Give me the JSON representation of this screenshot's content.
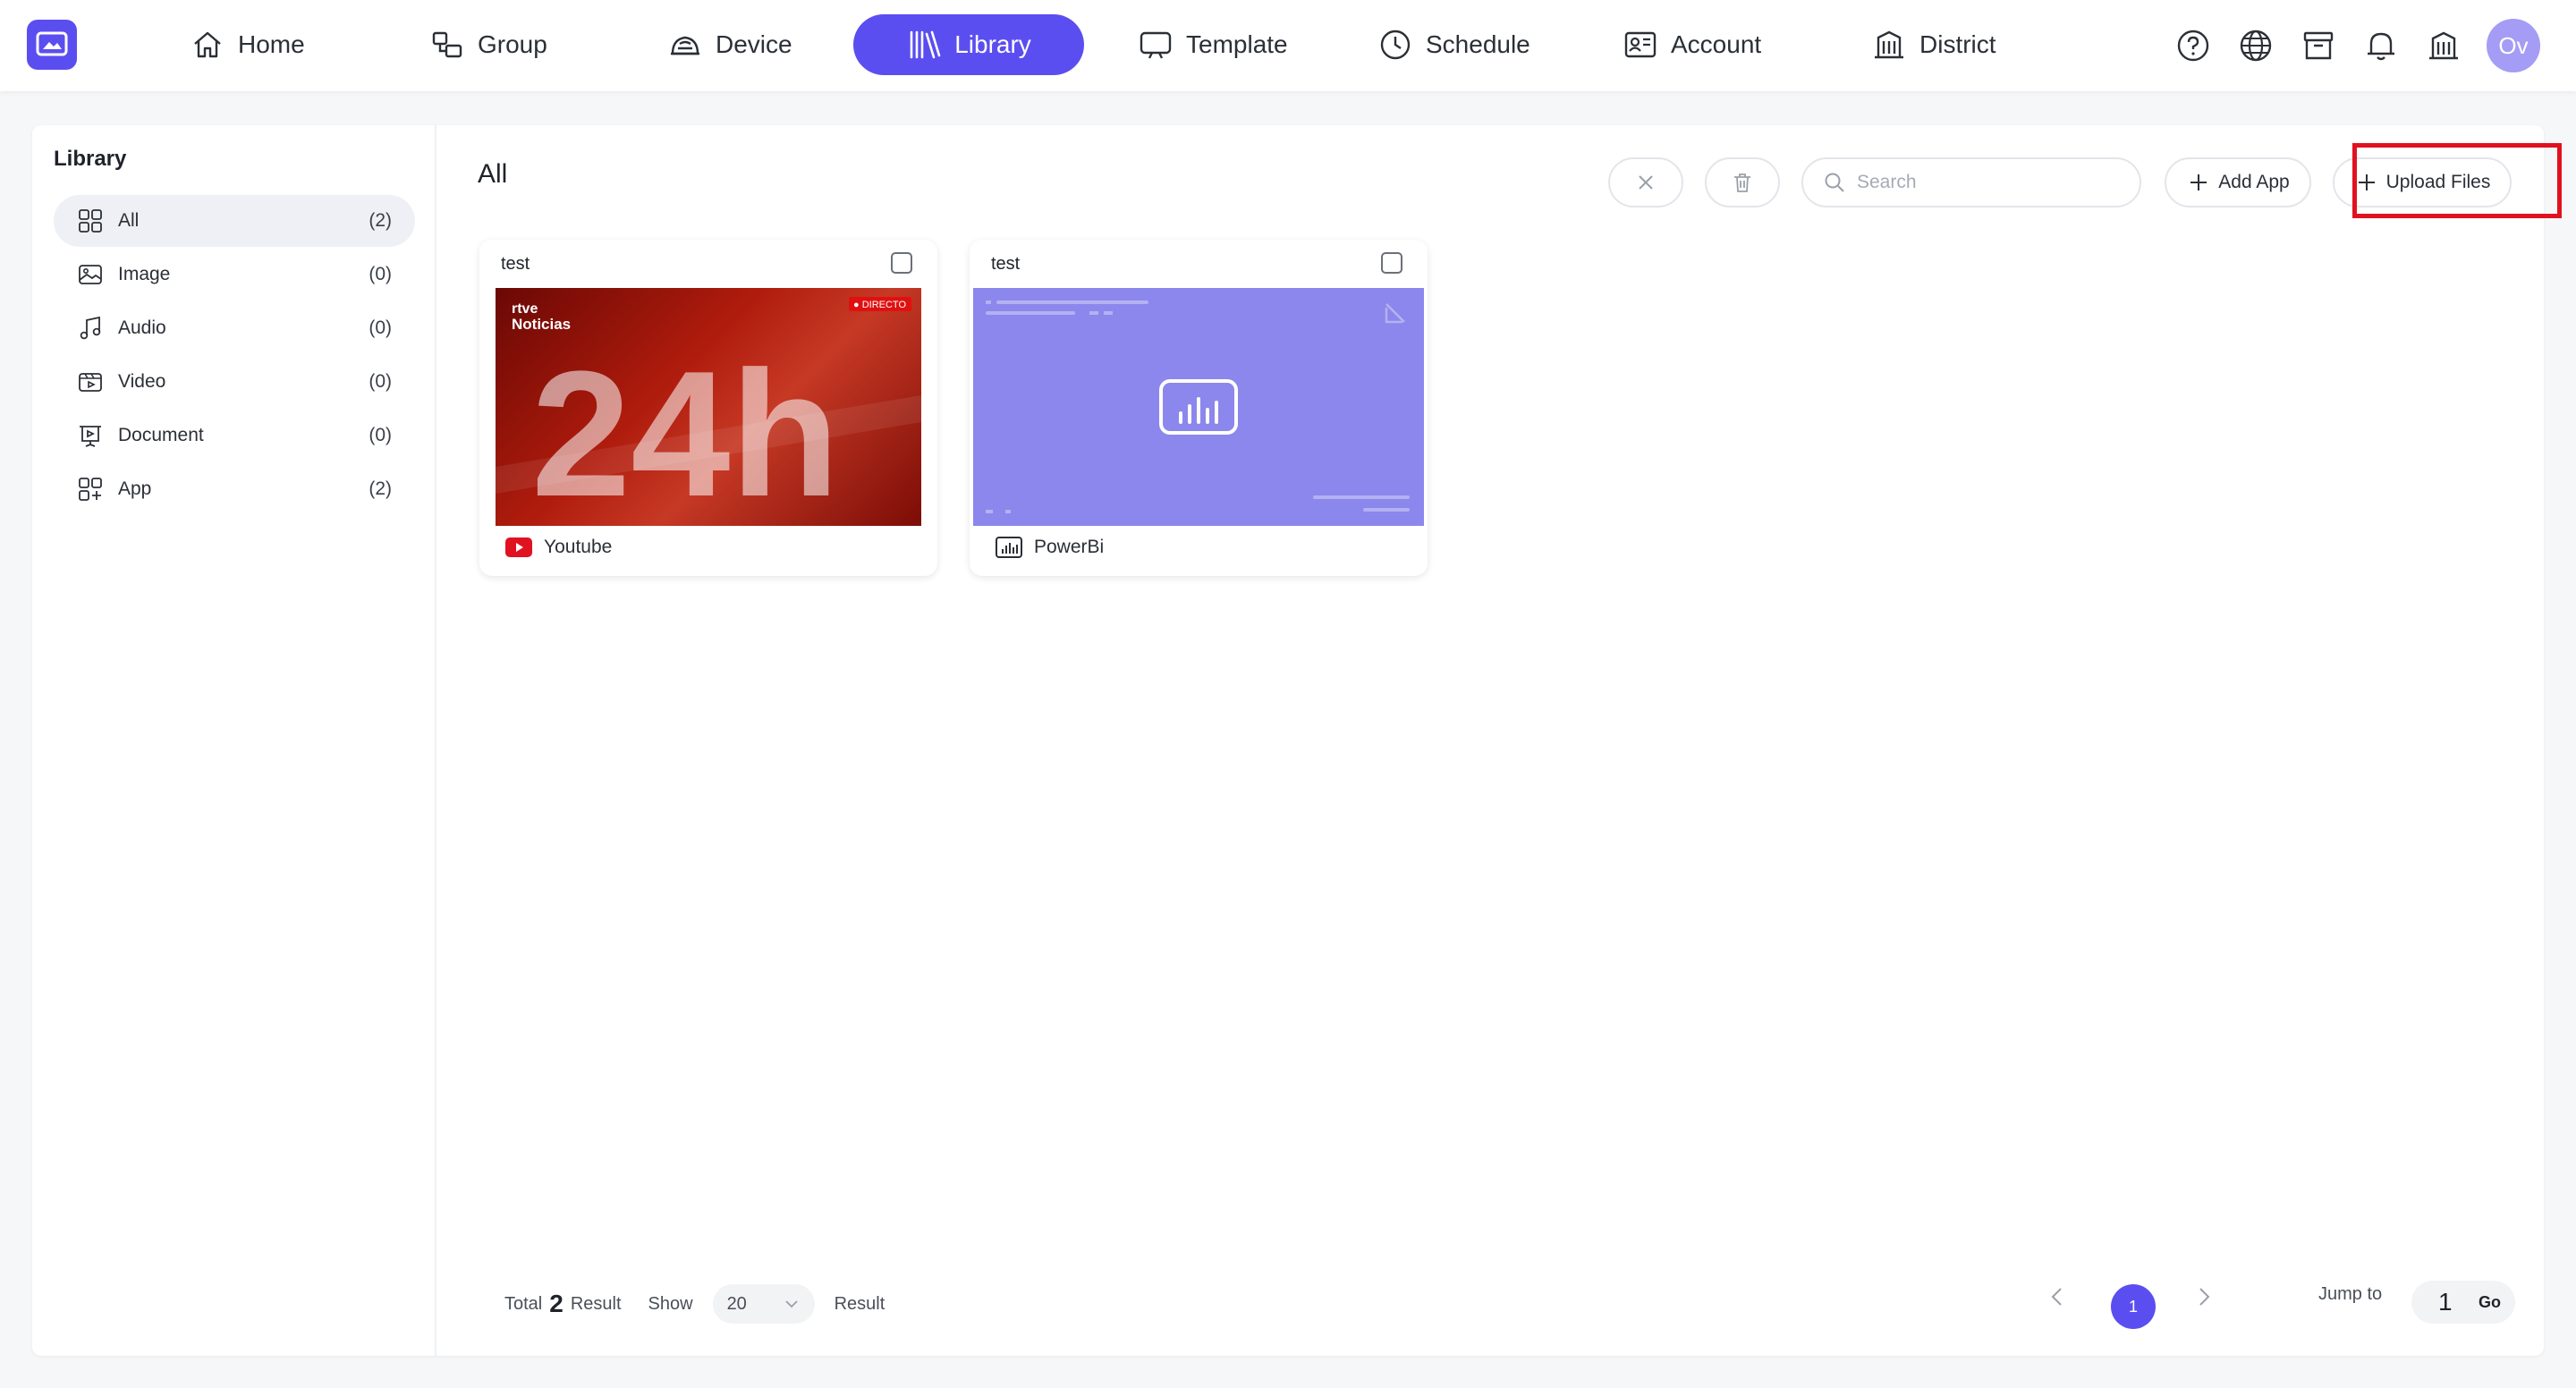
{
  "nav": {
    "items": [
      {
        "label": "Home",
        "icon": "home-icon"
      },
      {
        "label": "Group",
        "icon": "group-icon"
      },
      {
        "label": "Device",
        "icon": "device-icon"
      },
      {
        "label": "Library",
        "icon": "library-icon",
        "active": true
      },
      {
        "label": "Template",
        "icon": "template-icon"
      },
      {
        "label": "Schedule",
        "icon": "clock-icon"
      },
      {
        "label": "Account",
        "icon": "account-icon"
      },
      {
        "label": "District",
        "icon": "building-icon"
      }
    ],
    "right_icons": [
      "help-icon",
      "globe-icon",
      "archive-icon",
      "bell-icon",
      "building-icon"
    ],
    "avatar_initials": "Ov",
    "accent_color": "#5b4ef0"
  },
  "sidebar": {
    "title": "Library",
    "items": [
      {
        "label": "All",
        "count": "(2)",
        "icon": "grid-icon",
        "active": true
      },
      {
        "label": "Image",
        "count": "(0)",
        "icon": "image-icon"
      },
      {
        "label": "Audio",
        "count": "(0)",
        "icon": "music-icon"
      },
      {
        "label": "Video",
        "count": "(0)",
        "icon": "video-icon"
      },
      {
        "label": "Document",
        "count": "(0)",
        "icon": "document-icon"
      },
      {
        "label": "App",
        "count": "(2)",
        "icon": "app-icon"
      }
    ]
  },
  "main": {
    "title": "All",
    "search_placeholder": "Search",
    "add_app_label": "Add App",
    "upload_label": "Upload Files",
    "highlight_color": "#e0121f"
  },
  "cards": [
    {
      "title": "test",
      "app_name": "Youtube",
      "app_icon": "youtube-icon",
      "thumb_brand_top": "rtve",
      "thumb_brand": "Noticias",
      "thumb_big": "24h",
      "thumb_badge": "● DIRECTO"
    },
    {
      "title": "test",
      "app_name": "PowerBi",
      "app_icon": "powerbi-icon"
    }
  ],
  "footer": {
    "total_prefix": "Total",
    "total_count": "2",
    "total_suffix": "Result",
    "show_label": "Show",
    "page_size": "20",
    "result_label": "Result",
    "current_page": "1",
    "jump_label": "Jump to",
    "jump_value": "1",
    "go_label": "Go"
  }
}
